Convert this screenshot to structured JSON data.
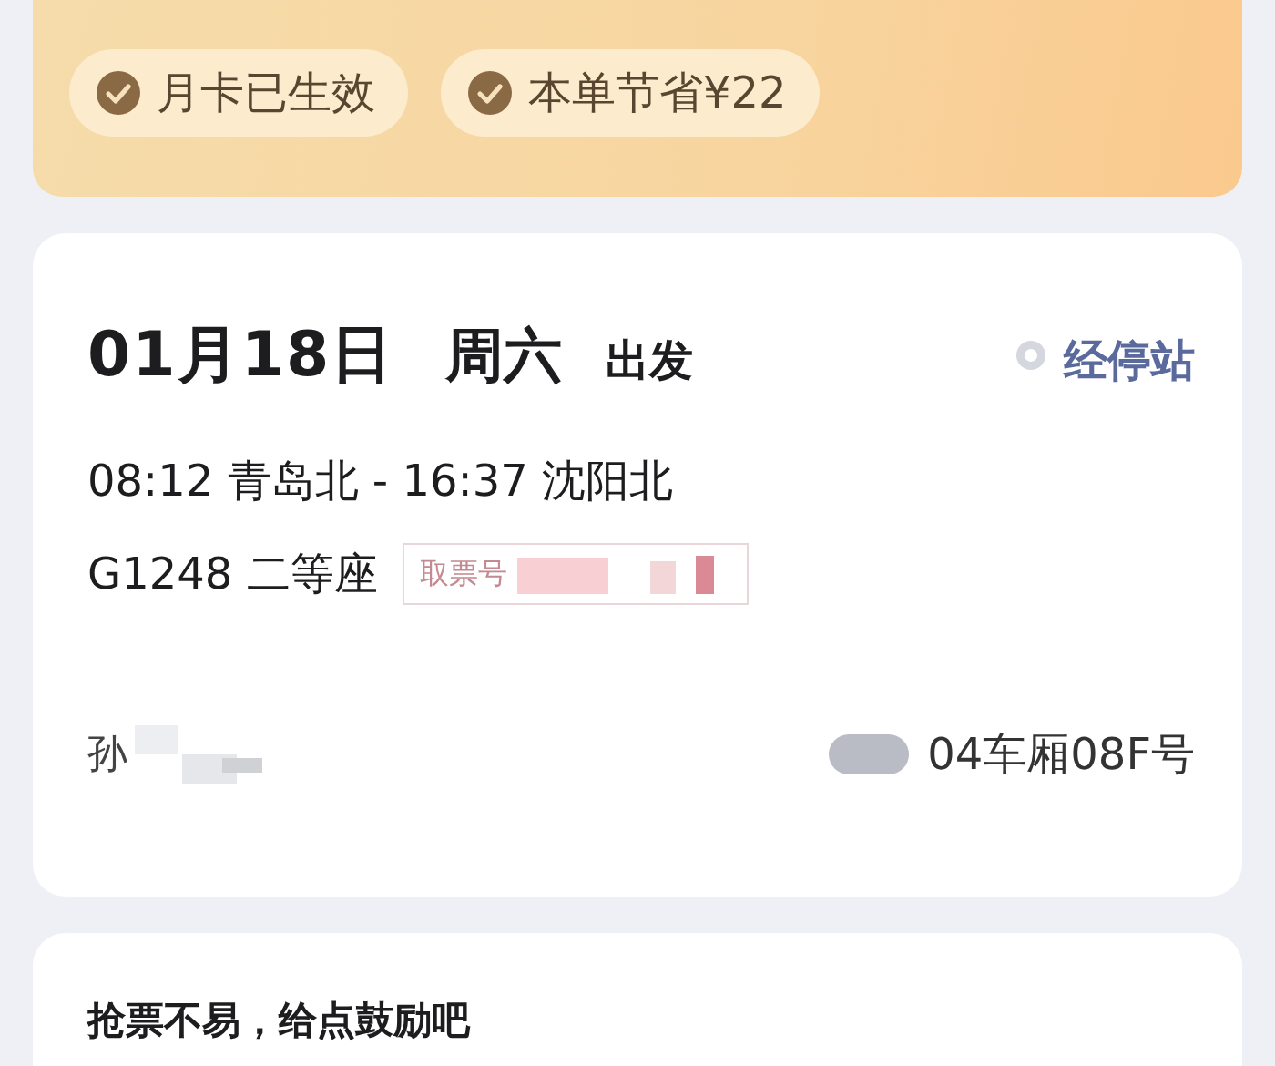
{
  "benefit_chips": [
    {
      "label": "月卡已生效",
      "checked": true
    },
    {
      "label": "本单节省¥22",
      "checked": true
    }
  ],
  "trip": {
    "date": "01月18日",
    "weekday": "周六",
    "status": "出发",
    "stops_link": "经停站",
    "route": "08:12 青岛北 - 16:37 沈阳北",
    "train": "G1248 二等座",
    "ticket_code_label": "取票号",
    "passenger_initial": "孙",
    "seat": "04车厢08F号"
  },
  "encourage": {
    "title": "抢票不易，给点鼓励吧"
  }
}
